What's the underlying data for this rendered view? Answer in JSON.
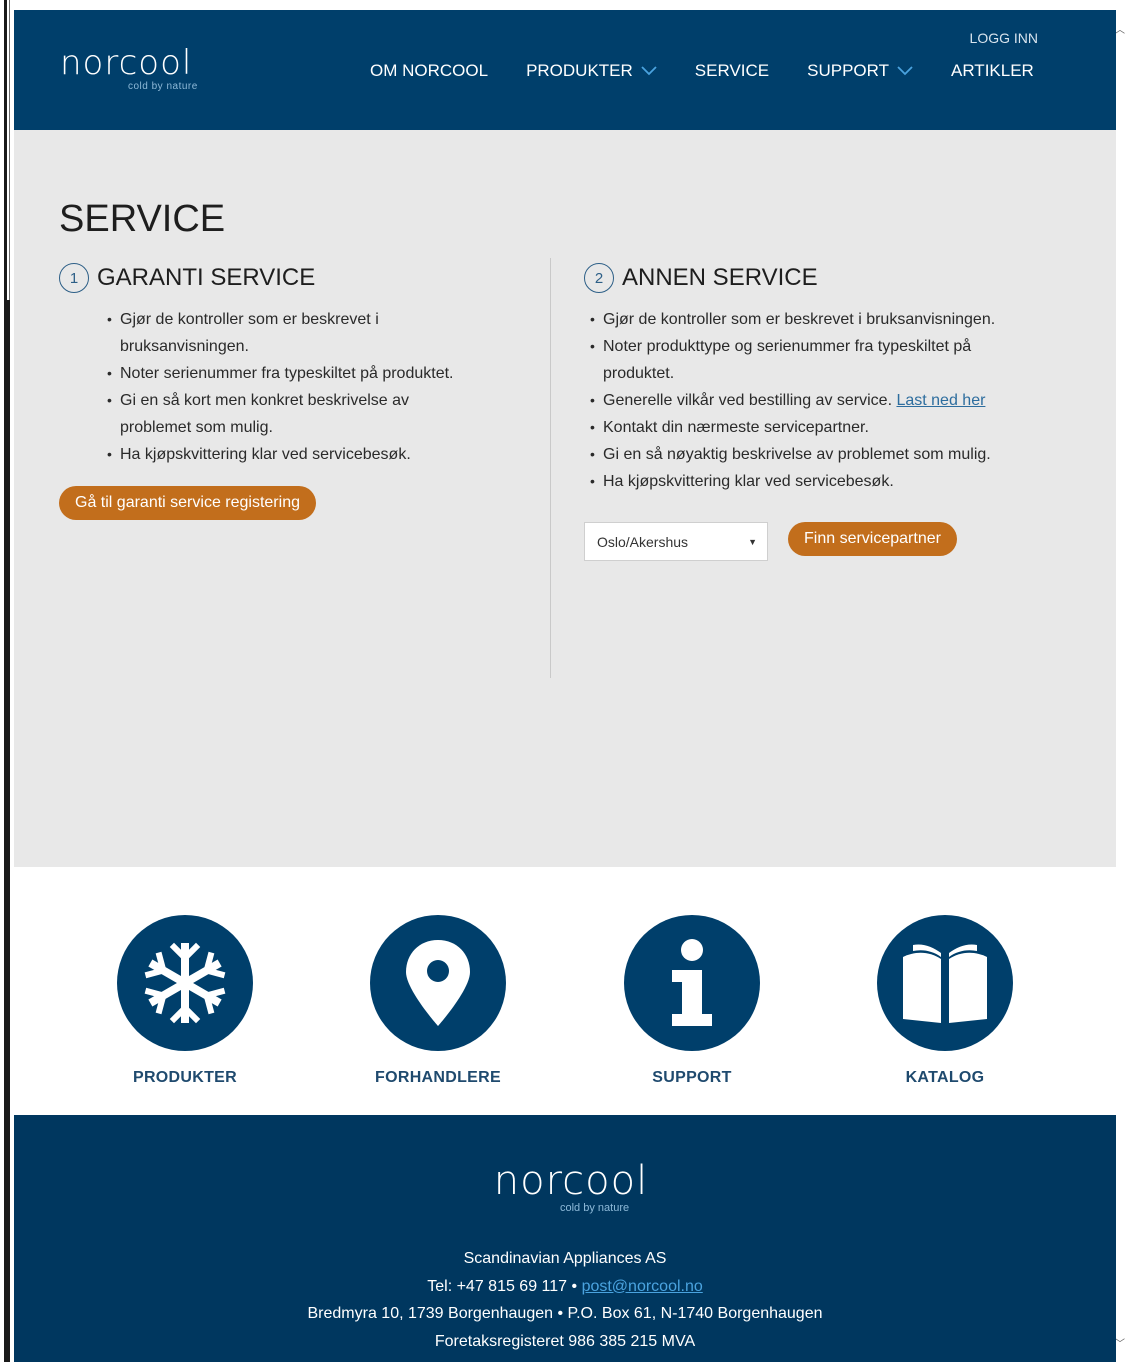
{
  "brand": {
    "name": "norcool",
    "tagline": "cold by nature"
  },
  "nav": {
    "login": "LOGG INN",
    "items": [
      {
        "label": "OM NORCOOL",
        "dropdown": false
      },
      {
        "label": "PRODUKTER",
        "dropdown": true
      },
      {
        "label": "SERVICE",
        "dropdown": false
      },
      {
        "label": "SUPPORT",
        "dropdown": true
      },
      {
        "label": "ARTIKLER",
        "dropdown": false
      }
    ]
  },
  "main": {
    "title": "SERVICE",
    "warranty": {
      "number": "1",
      "title": "GARANTI SERVICE",
      "bullets": [
        "Gjør de kontroller som er beskrevet i bruksanvisningen.",
        "Noter serienummer fra typeskiltet på produktet.",
        "Gi en så kort men konkret beskrivelse av problemet som mulig.",
        "Ha kjøpskvittering klar ved servicebesøk."
      ],
      "button": "Gå til garanti service registering"
    },
    "other": {
      "number": "2",
      "title": "ANNEN SERVICE",
      "bullets": [
        "Gjør de kontroller som er beskrevet i bruksanvisningen.",
        "Noter produkttype og serienummer fra typeskiltet på produktet.",
        "Generelle vilkår ved bestilling av service.",
        "Kontakt din nærmeste servicepartner.",
        "Gi en så nøyaktig beskrivelse av problemet som mulig.",
        "Ha kjøpskvittering klar ved servicebesøk."
      ],
      "download_link": "Last ned her",
      "region_selected": "Oslo/Akershus",
      "button": "Finn servicepartner"
    }
  },
  "quicklinks": [
    {
      "label": "PRODUKTER",
      "icon": "snowflake-icon"
    },
    {
      "label": "FORHANDLERE",
      "icon": "map-pin-icon"
    },
    {
      "label": "SUPPORT",
      "icon": "info-icon"
    },
    {
      "label": "KATALOG",
      "icon": "book-icon"
    }
  ],
  "footer": {
    "company": "Scandinavian Appliances AS",
    "tel": "Tel: +47 815 69 117 •",
    "email": "post@norcool.no",
    "address": "Bredmyra 10, 1739 Borgenhaugen • P.O. Box 61, N-1740 Borgenhaugen",
    "registry": "Foretaksregisteret 986 385 215 MVA"
  },
  "colors": {
    "header": "#003f6b",
    "footer": "#00375f",
    "accent_button": "#c26e1c",
    "nav_chevron": "#4aa3df"
  }
}
